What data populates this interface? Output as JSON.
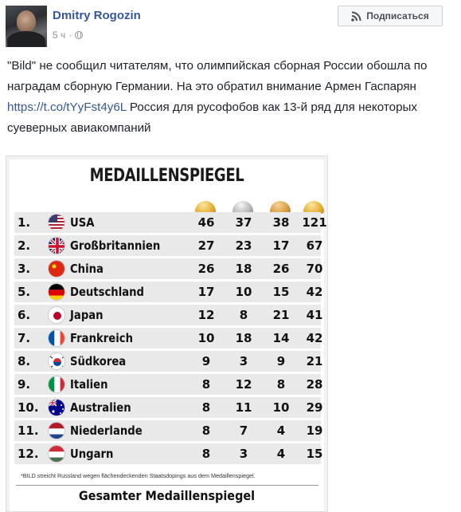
{
  "post": {
    "author": "Dmitry Rogozin",
    "time": "5 ч",
    "separator": "·",
    "subscribe_label": "Подписаться",
    "text_line1": "\"Bild\" не сообщил читателям, что олимпийская сборная России обошла по наградам сборную Германии. На это обратил внимание Армен Гаспарян",
    "link": "https://t.co/tYyFst4y6L",
    "text_line2": " Россия для русофобов как 13-й ряд для некоторых суеверных авиакомпаний"
  },
  "image": {
    "title": "MEDAILLENSPIEGEL",
    "footnote": "*BILD streicht Russland wegen flächendeckenden Staatsdopings aus dem Medaillenspiegel.",
    "bottom_title": "Gesamter Medaillenspiegel",
    "rows": [
      {
        "rank": "1.",
        "country": "USA",
        "gold": "46",
        "silver": "37",
        "bronze": "38",
        "total": "121",
        "flag": "usa"
      },
      {
        "rank": "2.",
        "country": "Großbritannien",
        "gold": "27",
        "silver": "23",
        "bronze": "17",
        "total": "67",
        "flag": "gb"
      },
      {
        "rank": "3.",
        "country": "China",
        "gold": "26",
        "silver": "18",
        "bronze": "26",
        "total": "70",
        "flag": "china"
      },
      {
        "rank": "5.",
        "country": "Deutschland",
        "gold": "17",
        "silver": "10",
        "bronze": "15",
        "total": "42",
        "flag": "germany"
      },
      {
        "rank": "6.",
        "country": "Japan",
        "gold": "12",
        "silver": "8",
        "bronze": "21",
        "total": "41",
        "flag": "japan"
      },
      {
        "rank": "7.",
        "country": "Frankreich",
        "gold": "10",
        "silver": "18",
        "bronze": "14",
        "total": "42",
        "flag": "france"
      },
      {
        "rank": "8.",
        "country": "Südkorea",
        "gold": "9",
        "silver": "3",
        "bronze": "9",
        "total": "21",
        "flag": "korea"
      },
      {
        "rank": "9.",
        "country": "Italien",
        "gold": "8",
        "silver": "12",
        "bronze": "8",
        "total": "28",
        "flag": "italy"
      },
      {
        "rank": "10.",
        "country": "Australien",
        "gold": "8",
        "silver": "11",
        "bronze": "10",
        "total": "29",
        "flag": "australia"
      },
      {
        "rank": "11.",
        "country": "Niederlande",
        "gold": "8",
        "silver": "7",
        "bronze": "4",
        "total": "19",
        "flag": "netherlands"
      },
      {
        "rank": "12.",
        "country": "Ungarn",
        "gold": "8",
        "silver": "3",
        "bronze": "4",
        "total": "15",
        "flag": "hungary"
      }
    ]
  },
  "colors": {
    "link": "#365899",
    "meta": "#90949c",
    "text": "#1d2129"
  }
}
